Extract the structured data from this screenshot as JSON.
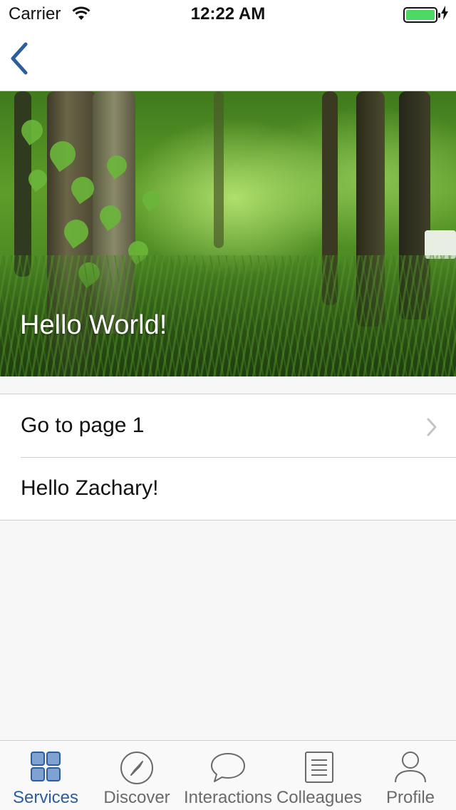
{
  "status_bar": {
    "carrier": "Carrier",
    "time": "12:22 AM",
    "battery_level": 1.0,
    "battery_color": "#4cd964"
  },
  "nav": {
    "back_icon": "chevron-left-icon",
    "accent": "#2b5ea1"
  },
  "hero": {
    "title": "Hello World!",
    "image": "forest-photo"
  },
  "list": {
    "items": [
      {
        "label": "Go to page 1",
        "has_chevron": true
      },
      {
        "label": "Hello Zachary!",
        "has_chevron": false
      }
    ]
  },
  "tab_bar": {
    "active_index": 0,
    "active_color": "#2b5ea1",
    "inactive_color": "#6a6a6a",
    "tabs": [
      {
        "label": "Services",
        "icon": "grid-icon"
      },
      {
        "label": "Discover",
        "icon": "compass-icon"
      },
      {
        "label": "Interactions",
        "icon": "chat-bubble-icon"
      },
      {
        "label": "Colleagues",
        "icon": "document-icon"
      },
      {
        "label": "Profile",
        "icon": "person-icon"
      }
    ]
  }
}
